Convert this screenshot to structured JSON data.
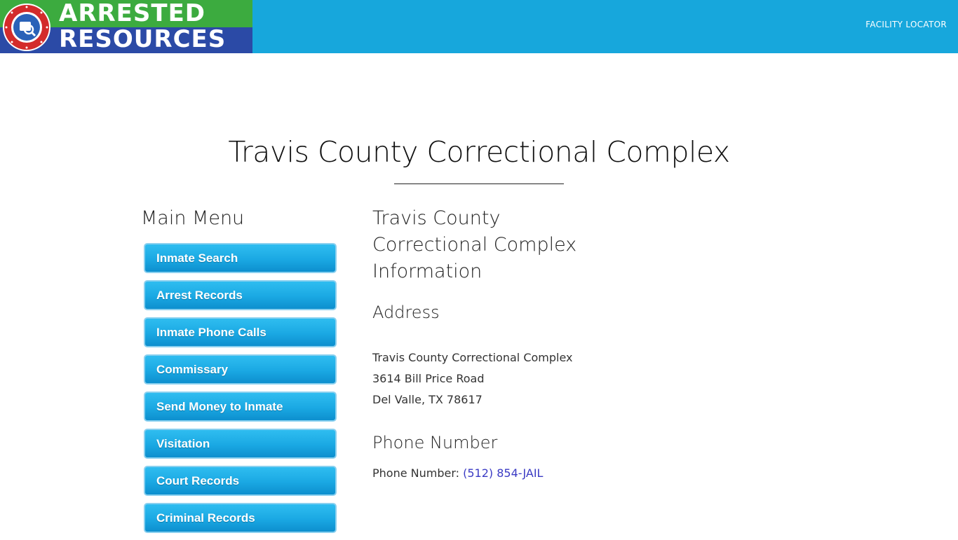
{
  "header": {
    "logo": {
      "line1": "ARRESTED",
      "line2": "RESOURCES",
      "seal_text": "ARRESTED RESOURCES",
      "seal_icon": "search-records-icon"
    },
    "nav": {
      "facility_locator": "FACILITY LOCATOR"
    },
    "colors": {
      "header_bg": "#17a7dc",
      "logo_green": "#3cab3f",
      "logo_blue": "#2b4aa6"
    }
  },
  "page": {
    "title": "Travis County Correctional Complex"
  },
  "sidebar": {
    "heading": "Main Menu",
    "items": [
      {
        "label": "Inmate Search"
      },
      {
        "label": "Arrest Records"
      },
      {
        "label": "Inmate Phone Calls"
      },
      {
        "label": "Commissary"
      },
      {
        "label": "Send Money to Inmate"
      },
      {
        "label": "Visitation"
      },
      {
        "label": "Court Records"
      },
      {
        "label": "Criminal Records"
      }
    ]
  },
  "main": {
    "info_heading": "Travis County Correctional Complex Information",
    "address": {
      "heading": "Address",
      "line1": "Travis County Correctional Complex",
      "line2": "3614 Bill Price Road",
      "line3": "Del Valle, TX 78617"
    },
    "phone": {
      "heading": "Phone Number",
      "label": "Phone Number: ",
      "value": "(512) 854-JAIL"
    }
  }
}
